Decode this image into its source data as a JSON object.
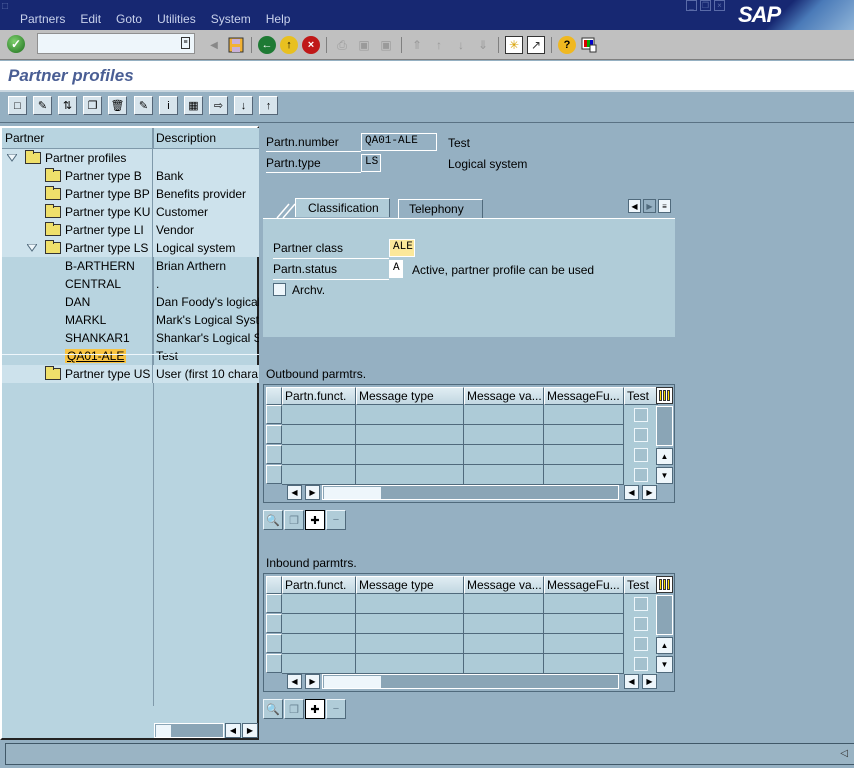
{
  "menu": [
    "Partners",
    "Edit",
    "Goto",
    "Utilities",
    "System",
    "Help"
  ],
  "window_controls": [
    "minimize",
    "restore",
    "close"
  ],
  "brand": "SAP",
  "command_field": {
    "value": "",
    "placeholder": ""
  },
  "system_toolbar_icons": [
    "enter-icon",
    "back-triangle-icon",
    "save-icon",
    "back-icon",
    "exit-icon",
    "cancel-icon",
    "print-icon",
    "find-icon",
    "find-next-icon",
    "first-page-icon",
    "previous-page-icon",
    "next-page-icon",
    "last-page-icon",
    "create-session-icon",
    "shortcut-icon",
    "help-icon",
    "layout-menu-icon"
  ],
  "page_title": "Partner profiles",
  "app_toolbar_icons": [
    "create-icon",
    "change-icon",
    "display-change-icon",
    "copy-icon",
    "delete-icon",
    "check-icon",
    "info-icon",
    "hierarchy-icon",
    "import-icon",
    "add-record-icon",
    "remove-record-icon"
  ],
  "tree": {
    "col_partner": "Partner",
    "col_description": "Description",
    "rows": [
      {
        "label": "Partner profiles",
        "desc": "",
        "level": 0,
        "type": "folder",
        "expanded": true
      },
      {
        "label": "Partner type B",
        "desc": "Bank",
        "level": 1,
        "type": "folder"
      },
      {
        "label": "Partner type BP",
        "desc": "Benefits provider",
        "level": 1,
        "type": "folder"
      },
      {
        "label": "Partner type KU",
        "desc": "Customer",
        "level": 1,
        "type": "folder"
      },
      {
        "label": "Partner type LI",
        "desc": "Vendor",
        "level": 1,
        "type": "folder"
      },
      {
        "label": "Partner type LS",
        "desc": "Logical system",
        "level": 1,
        "type": "folder-open",
        "expanded": true
      },
      {
        "label": "B-ARTHERN",
        "desc": "Brian Arthern",
        "level": 2,
        "type": "leaf"
      },
      {
        "label": "CENTRAL",
        "desc": ".",
        "level": 2,
        "type": "leaf"
      },
      {
        "label": "DAN",
        "desc": "Dan Foody's logical",
        "level": 2,
        "type": "leaf"
      },
      {
        "label": "MARKL",
        "desc": "Mark's Logical Syst",
        "level": 2,
        "type": "leaf"
      },
      {
        "label": "SHANKAR1",
        "desc": "Shankar's Logical S",
        "level": 2,
        "type": "leaf"
      },
      {
        "label": "QA01-ALE",
        "desc": "Test",
        "level": 2,
        "type": "leaf",
        "selected": true
      },
      {
        "label": "Partner type US",
        "desc": "User (first 10 chara",
        "level": 1,
        "type": "folder"
      }
    ]
  },
  "header": {
    "partn_number_label": "Partn.number",
    "partn_number_value": "QA01-ALE",
    "partn_number_desc": "Test",
    "partn_type_label": "Partn.type",
    "partn_type_value": "LS",
    "partn_type_desc": "Logical system"
  },
  "tabs": [
    {
      "label": "Classification",
      "active": true
    },
    {
      "label": "Telephony",
      "active": false
    }
  ],
  "classification": {
    "partner_class_label": "Partner class",
    "partner_class_value": "ALE",
    "partn_status_label": "Partn.status",
    "partn_status_value": "A",
    "partn_status_desc": "Active, partner profile can be used",
    "archv_label": "Archv.",
    "archv_checked": false
  },
  "outbound": {
    "title": "Outbound parmtrs.",
    "columns": [
      "Partn.funct.",
      "Message type",
      "Message va...",
      "MessageFu...",
      "Test"
    ],
    "rows": [
      [
        "",
        "",
        "",
        "",
        false
      ],
      [
        "",
        "",
        "",
        "",
        false
      ],
      [
        "",
        "",
        "",
        "",
        false
      ],
      [
        "",
        "",
        "",
        "",
        false
      ]
    ]
  },
  "inbound": {
    "title": "Inbound parmtrs.",
    "columns": [
      "Partn.funct.",
      "Message type",
      "Message va...",
      "MessageFu...",
      "Test"
    ],
    "rows": [
      [
        "",
        "",
        "",
        "",
        false
      ],
      [
        "",
        "",
        "",
        "",
        false
      ],
      [
        "",
        "",
        "",
        "",
        false
      ],
      [
        "",
        "",
        "",
        "",
        false
      ]
    ]
  },
  "table_buttons": [
    "display-icon",
    "copy-entry-icon",
    "create-entry-icon",
    "delete-entry-icon"
  ],
  "status_text": ""
}
